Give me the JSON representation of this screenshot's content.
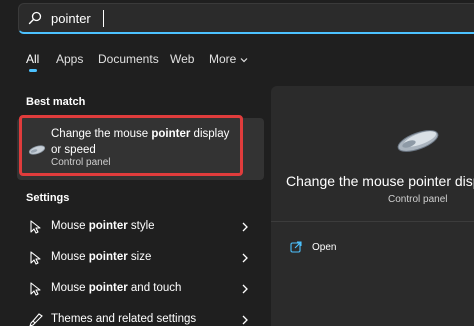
{
  "search": {
    "value": "pointer"
  },
  "tabs": [
    {
      "label": "All",
      "active": true
    },
    {
      "label": "Apps",
      "active": false
    },
    {
      "label": "Documents",
      "active": false
    },
    {
      "label": "Web",
      "active": false
    },
    {
      "label": "More",
      "active": false,
      "icon": "chevron-down-icon"
    }
  ],
  "best_match": {
    "heading": "Best match",
    "title_pre": "Change the mouse ",
    "title_bold": "pointer",
    "title_post": " display or speed",
    "subtitle": "Control panel",
    "icon": "mouse-icon",
    "highlight_color": "#e03c3c"
  },
  "settings": {
    "heading": "Settings",
    "items": [
      {
        "pre": "Mouse ",
        "bold": "pointer",
        "post": " style",
        "icon": "mouse-pointer-icon"
      },
      {
        "pre": "Mouse ",
        "bold": "pointer",
        "post": " size",
        "icon": "mouse-pointer-icon"
      },
      {
        "pre": "Mouse ",
        "bold": "pointer",
        "post": " and touch",
        "icon": "mouse-pointer-icon"
      },
      {
        "pre": "Themes and related settings",
        "bold": "",
        "post": "",
        "icon": "brush-icon"
      }
    ]
  },
  "detail": {
    "title": "Change the mouse pointer displ",
    "subtitle": "Control panel",
    "open_label": "Open",
    "icon": "mouse-icon"
  },
  "colors": {
    "accent": "#4cc2ff",
    "highlight": "#e03c3c",
    "background": "#1f1f1f",
    "pane": "#2b2b2b"
  }
}
